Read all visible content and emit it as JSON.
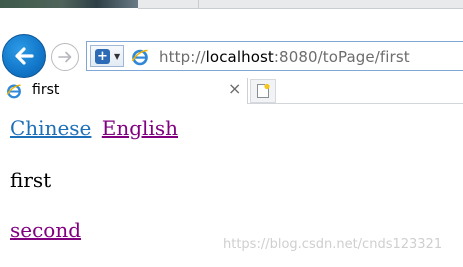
{
  "browser": {
    "address_bar": {
      "url_prefix": "http://",
      "url_host": "localhost",
      "url_rest": ":8080/toPage/first"
    },
    "tab": {
      "title": "first",
      "close_glyph": "×"
    },
    "icons": {
      "back": "back-arrow-icon",
      "forward": "forward-arrow-icon",
      "favorites": "add-favorite-icon",
      "page": "ie-page-icon",
      "new_tab": "new-tab-icon"
    },
    "colors": {
      "back_button": "#1276c9",
      "address_border": "#7fa8d8"
    }
  },
  "page": {
    "links": {
      "chinese": "Chinese",
      "english": "English"
    },
    "text": "first",
    "second_link": "second",
    "link_colors": {
      "unvisited": "#1d6fb8",
      "visited": "#800080"
    }
  },
  "watermark": "https://blog.csdn.net/cnds123321"
}
